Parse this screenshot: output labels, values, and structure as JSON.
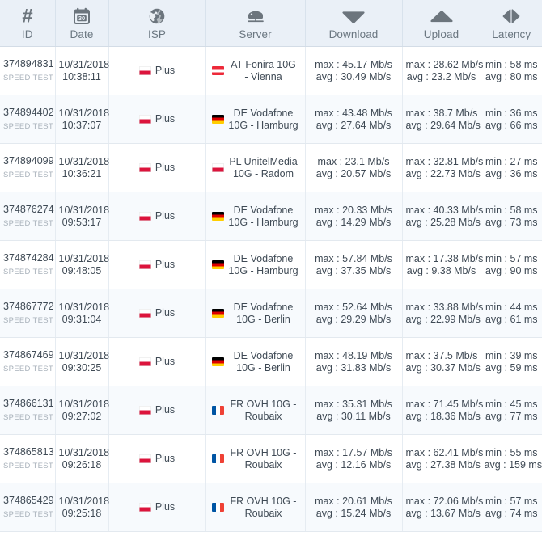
{
  "table": {
    "columns": [
      {
        "key": "id",
        "label": "ID",
        "icon": "hash-icon"
      },
      {
        "key": "date",
        "label": "Date",
        "icon": "calendar-icon",
        "icon_text": "30"
      },
      {
        "key": "isp",
        "label": "ISP",
        "icon": "globe-icon"
      },
      {
        "key": "server",
        "label": "Server",
        "icon": "server-icon"
      },
      {
        "key": "download",
        "label": "Download",
        "icon": "triangle-down-icon"
      },
      {
        "key": "upload",
        "label": "Upload",
        "icon": "triangle-up-icon"
      },
      {
        "key": "latency",
        "label": "Latency",
        "icon": "latency-arrows-icon"
      }
    ],
    "id_sublabel": "SPEED TEST",
    "rows": [
      {
        "id": "374894831",
        "sub": "SPEED TEST",
        "date": "10/31/2018",
        "time": "10:38:11",
        "isp_flag": "pl",
        "isp": "Plus",
        "server_flag": "at",
        "server": "AT Fonira 10G - Vienna",
        "download_max": "max : 45.17 Mb/s",
        "download_avg": "avg : 30.49 Mb/s",
        "upload_max": "max : 28.62 Mb/s",
        "upload_avg": "avg : 23.2 Mb/s",
        "latency_min": "min : 58 ms",
        "latency_avg": "avg : 80 ms"
      },
      {
        "id": "374894402",
        "sub": "SPEED TEST",
        "date": "10/31/2018",
        "time": "10:37:07",
        "isp_flag": "pl",
        "isp": "Plus",
        "server_flag": "de",
        "server": "DE Vodafone 10G - Hamburg",
        "download_max": "max : 43.48 Mb/s",
        "download_avg": "avg : 27.64 Mb/s",
        "upload_max": "max : 38.7 Mb/s",
        "upload_avg": "avg : 29.64 Mb/s",
        "latency_min": "min : 36 ms",
        "latency_avg": "avg : 66 ms"
      },
      {
        "id": "374894099",
        "sub": "SPEED TEST",
        "date": "10/31/2018",
        "time": "10:36:21",
        "isp_flag": "pl",
        "isp": "Plus",
        "server_flag": "pl",
        "server": "PL UnitelMedia 10G - Radom",
        "download_max": "max : 23.1 Mb/s",
        "download_avg": "avg : 20.57 Mb/s",
        "upload_max": "max : 32.81 Mb/s",
        "upload_avg": "avg : 22.73 Mb/s",
        "latency_min": "min : 27 ms",
        "latency_avg": "avg : 36 ms"
      },
      {
        "id": "374876274",
        "sub": "SPEED TEST",
        "date": "10/31/2018",
        "time": "09:53:17",
        "isp_flag": "pl",
        "isp": "Plus",
        "server_flag": "de",
        "server": "DE Vodafone 10G - Hamburg",
        "download_max": "max : 20.33 Mb/s",
        "download_avg": "avg : 14.29 Mb/s",
        "upload_max": "max : 40.33 Mb/s",
        "upload_avg": "avg : 25.28 Mb/s",
        "latency_min": "min : 58 ms",
        "latency_avg": "avg : 73 ms"
      },
      {
        "id": "374874284",
        "sub": "SPEED TEST",
        "date": "10/31/2018",
        "time": "09:48:05",
        "isp_flag": "pl",
        "isp": "Plus",
        "server_flag": "de",
        "server": "DE Vodafone 10G - Hamburg",
        "download_max": "max : 57.84 Mb/s",
        "download_avg": "avg : 37.35 Mb/s",
        "upload_max": "max : 17.38 Mb/s",
        "upload_avg": "avg : 9.38 Mb/s",
        "latency_min": "min : 57 ms",
        "latency_avg": "avg : 90 ms"
      },
      {
        "id": "374867772",
        "sub": "SPEED TEST",
        "date": "10/31/2018",
        "time": "09:31:04",
        "isp_flag": "pl",
        "isp": "Plus",
        "server_flag": "de",
        "server": "DE Vodafone 10G - Berlin",
        "download_max": "max : 52.64 Mb/s",
        "download_avg": "avg : 29.29 Mb/s",
        "upload_max": "max : 33.88 Mb/s",
        "upload_avg": "avg : 22.99 Mb/s",
        "latency_min": "min : 44 ms",
        "latency_avg": "avg : 61 ms"
      },
      {
        "id": "374867469",
        "sub": "SPEED TEST",
        "date": "10/31/2018",
        "time": "09:30:25",
        "isp_flag": "pl",
        "isp": "Plus",
        "server_flag": "de",
        "server": "DE Vodafone 10G - Berlin",
        "download_max": "max : 48.19 Mb/s",
        "download_avg": "avg : 31.83 Mb/s",
        "upload_max": "max : 37.5 Mb/s",
        "upload_avg": "avg : 30.37 Mb/s",
        "latency_min": "min : 39 ms",
        "latency_avg": "avg : 59 ms"
      },
      {
        "id": "374866131",
        "sub": "SPEED TEST",
        "date": "10/31/2018",
        "time": "09:27:02",
        "isp_flag": "pl",
        "isp": "Plus",
        "server_flag": "fr",
        "server": "FR OVH 10G - Roubaix",
        "download_max": "max : 35.31 Mb/s",
        "download_avg": "avg : 30.11 Mb/s",
        "upload_max": "max : 71.45 Mb/s",
        "upload_avg": "avg : 18.36 Mb/s",
        "latency_min": "min : 45 ms",
        "latency_avg": "avg : 77 ms"
      },
      {
        "id": "374865813",
        "sub": "SPEED TEST",
        "date": "10/31/2018",
        "time": "09:26:18",
        "isp_flag": "pl",
        "isp": "Plus",
        "server_flag": "fr",
        "server": "FR OVH 10G - Roubaix",
        "download_max": "max : 17.57 Mb/s",
        "download_avg": "avg : 12.16 Mb/s",
        "upload_max": "max : 62.41 Mb/s",
        "upload_avg": "avg : 27.38 Mb/s",
        "latency_min": "min : 55 ms",
        "latency_avg": "avg : 159 ms"
      },
      {
        "id": "374865429",
        "sub": "SPEED TEST",
        "date": "10/31/2018",
        "time": "09:25:18",
        "isp_flag": "pl",
        "isp": "Plus",
        "server_flag": "fr",
        "server": "FR OVH 10G - Roubaix",
        "download_max": "max : 20.61 Mb/s",
        "download_avg": "avg : 15.24 Mb/s",
        "upload_max": "max : 72.06 Mb/s",
        "upload_avg": "avg : 13.67 Mb/s",
        "latency_min": "min : 57 ms",
        "latency_avg": "avg : 74 ms"
      }
    ]
  },
  "colors": {
    "header_bg": "#eaf0f7",
    "row_alt_bg": "#f7fafd",
    "text": "#3f4a55",
    "muted": "#a9b2bb",
    "icon": "#6c757d"
  }
}
